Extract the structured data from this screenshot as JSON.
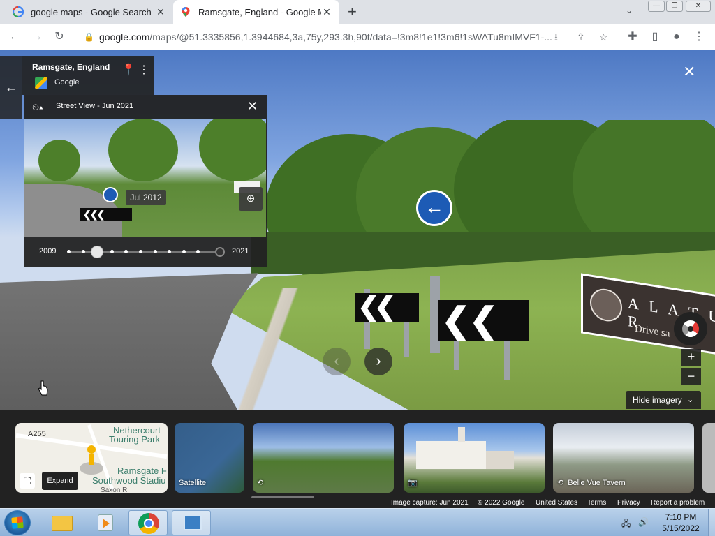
{
  "browser": {
    "tabs": [
      {
        "title": "google maps - Google Search",
        "active": false,
        "icon": "google-g-icon"
      },
      {
        "title": "Ramsgate, England - Google Maps",
        "active": true,
        "icon": "google-maps-icon"
      }
    ],
    "new_tab_label": "+",
    "address": {
      "domain": "google.com",
      "path": "/maps/@51.3335856,1.3944684,3a,75y,293.3h,90t/data=!3m8!1e1!3m6!1sWATu8mIMVF1-..."
    }
  },
  "place_card": {
    "title": "Ramsgate, England",
    "source": "Google"
  },
  "time_panel": {
    "title": "Street View - Jun 2021",
    "preview_date": "Jul 2012",
    "year_start": "2009",
    "year_end": "2021",
    "timeline_dots": 11,
    "selected_index": 2
  },
  "scene": {
    "sign_text": "A L A T U R",
    "sign_subtext": "Drive sa"
  },
  "controls": {
    "hide_imagery_label": "Hide imagery"
  },
  "imagery_strip": {
    "map_card": {
      "labels": [
        "A255",
        "Nethercourt",
        "Touring Park",
        "Ramsgate F",
        "Southwood Stadiu",
        "Saxon R"
      ],
      "expand_tooltip": "Expand"
    },
    "satellite_label": "Satellite",
    "photos": [
      {
        "label": "",
        "icon": "360-icon"
      },
      {
        "label": "",
        "icon": "camera-icon"
      },
      {
        "label": "Belle Vue Tavern",
        "icon": "360-icon"
      }
    ]
  },
  "footer": {
    "image_capture": "Image capture: Jun 2021",
    "copyright": "© 2022 Google",
    "region": "United States",
    "terms": "Terms",
    "privacy": "Privacy",
    "report": "Report a problem"
  },
  "taskbar": {
    "time": "7:10 PM",
    "date": "5/15/2022"
  }
}
